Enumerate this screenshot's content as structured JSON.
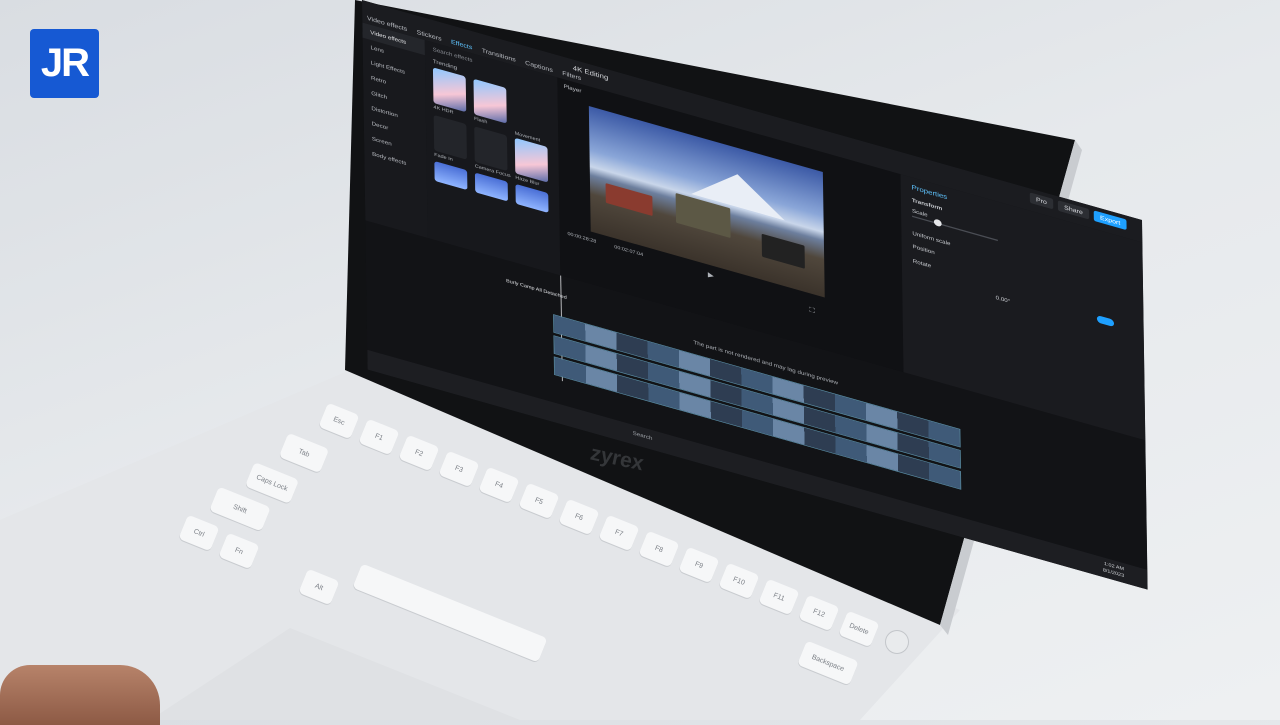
{
  "watermark": {
    "text": "JR",
    "color": "#1659d3"
  },
  "laptop": {
    "brand": "zyrex",
    "body_color": "#e4e6e9",
    "bezel_color": "#111214"
  },
  "app": {
    "tabs": [
      "Video effects",
      "Stickers",
      "Effects",
      "Transitions",
      "Captions",
      "Filters"
    ],
    "active_tab": "Effects",
    "title": "4K Editing",
    "top_buttons": {
      "pro": "Pro",
      "share": "Share",
      "export": "Export"
    },
    "left_menu": [
      "Video effects",
      "Lens",
      "Light Effects",
      "Retro",
      "Glitch",
      "Distortion",
      "Decor",
      "Screen",
      "Body effects"
    ],
    "media": {
      "search_placeholder": "Search effects",
      "trending": "Trending",
      "items": [
        "4K HDR",
        "Flash",
        "Fade In",
        "Camera Focus",
        "Haze Blur",
        "Movement"
      ]
    },
    "player": {
      "label": "Player",
      "time_current": "00:00:28:28",
      "time_total": "00:02:07:04"
    },
    "properties": {
      "title": "Properties",
      "section": "Transform",
      "scale": "Scale",
      "uniform_scale": "Uniform scale",
      "position": "Position",
      "rotate": "Rotate",
      "rotate_value": "0.00°"
    },
    "timeline": {
      "clip_name": "Burly Camp All Detached",
      "notice": "The part is not rendered and may lag during preview"
    },
    "taskbar": {
      "search": "Search",
      "time": "1:02 AM",
      "date": "8/1/2023"
    },
    "accent": "#1ea0ff"
  },
  "keyboard": {
    "labels": [
      "Esc",
      "F1",
      "F2",
      "F3",
      "F4",
      "F5",
      "F6",
      "F7",
      "F8",
      "F9",
      "F10",
      "F11",
      "F12",
      "Delete",
      "Backspace",
      "Tab",
      "Caps Lock",
      "Shift",
      "Ctrl",
      "Fn",
      "Alt"
    ]
  }
}
